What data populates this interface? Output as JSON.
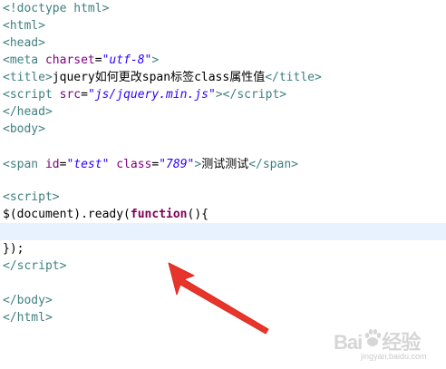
{
  "code": {
    "l1": {
      "open": "<!",
      "word": "doctype html",
      "close": ">"
    },
    "l2": {
      "open": "<",
      "word": "html",
      "close": ">"
    },
    "l3": {
      "open": "<",
      "word": "head",
      "close": ">"
    },
    "l4": {
      "open": "<",
      "word": "meta",
      "attr1": " charset",
      "eq1": "=",
      "val1": "\"utf-8\"",
      "close": ">"
    },
    "l5": {
      "open": "<",
      "word": "title",
      "close": ">",
      "text": "jquery如何更改span标签class属性值",
      "endopen": "</",
      "endword": "title",
      "endclose": ">"
    },
    "l6": {
      "open": "<",
      "word": "script",
      "attr1": " src",
      "eq1": "=",
      "val1": "\"js/jquery.min.js\"",
      "close": ">",
      "endopen": "</",
      "endword": "script",
      "endclose": ">"
    },
    "l7": {
      "open": "</",
      "word": "head",
      "close": ">"
    },
    "l8": {
      "open": "<",
      "word": "body",
      "close": ">"
    },
    "l10": {
      "open": "<",
      "word": "span",
      "attr1": " id",
      "eq1": "=",
      "val1": "\"test\"",
      "attr2": " class",
      "eq2": "=",
      "val2": "\"789\"",
      "close": ">",
      "text": "测试测试",
      "endopen": "</",
      "endword": "span",
      "endclose": ">"
    },
    "l12": {
      "open": "<",
      "word": "script",
      "close": ">"
    },
    "l13": {
      "pre": "$(document).ready(",
      "kw": "function",
      "post": "(){"
    },
    "l15": {
      "text": "});"
    },
    "l16": {
      "open": "</",
      "word": "script",
      "close": ">"
    },
    "l18": {
      "open": "</",
      "word": "body",
      "close": ">"
    },
    "l19": {
      "open": "</",
      "word": "html",
      "close": ">"
    }
  },
  "watermark": {
    "brand": "Bai",
    "brand2": "经验",
    "sub": "jingyan.baidu.com"
  },
  "colors": {
    "tag": "#3f7f7f",
    "attr": "#7f007f",
    "value": "#2a00ff",
    "keyword": "#7f0055",
    "current_line": "#e8f2fe",
    "arrow": "#e8352b"
  },
  "icons": {
    "arrow": "red-annotation-arrow",
    "paw": "baidu-paw-icon"
  }
}
